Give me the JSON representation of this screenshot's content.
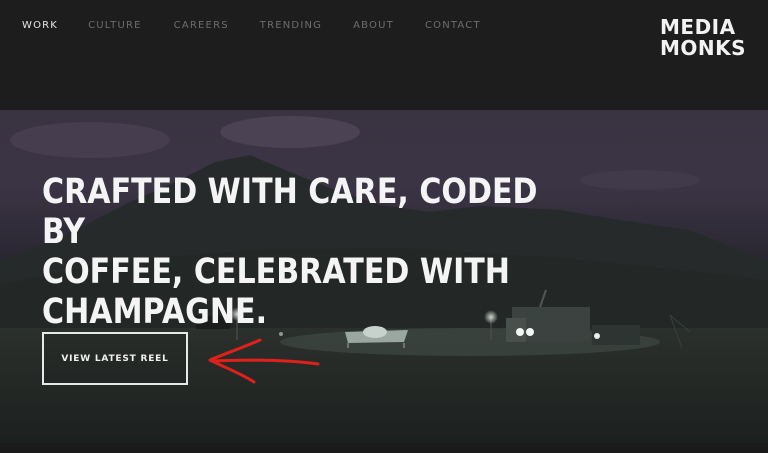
{
  "nav": {
    "items": [
      {
        "label": "WORK",
        "active": true
      },
      {
        "label": "CULTURE",
        "active": false
      },
      {
        "label": "CAREERS",
        "active": false
      },
      {
        "label": "TRENDING",
        "active": false
      },
      {
        "label": "ABOUT",
        "active": false
      },
      {
        "label": "CONTACT",
        "active": false
      }
    ]
  },
  "logo": {
    "line1": "MEDIA",
    "line2": "MONKS"
  },
  "hero": {
    "headline_line1": "CRAFTED WITH CARE, CODED BY",
    "headline_line2": "COFFEE, CELEBRATED WITH",
    "headline_line3": "CHAMPAGNE.",
    "cta_label": "VIEW LATEST REEL"
  },
  "colors": {
    "header_bg": "#1d1d1d",
    "nav_active": "#e6e6e6",
    "nav_inactive": "#6d6d6d",
    "annotation_arrow": "#e0201b"
  }
}
